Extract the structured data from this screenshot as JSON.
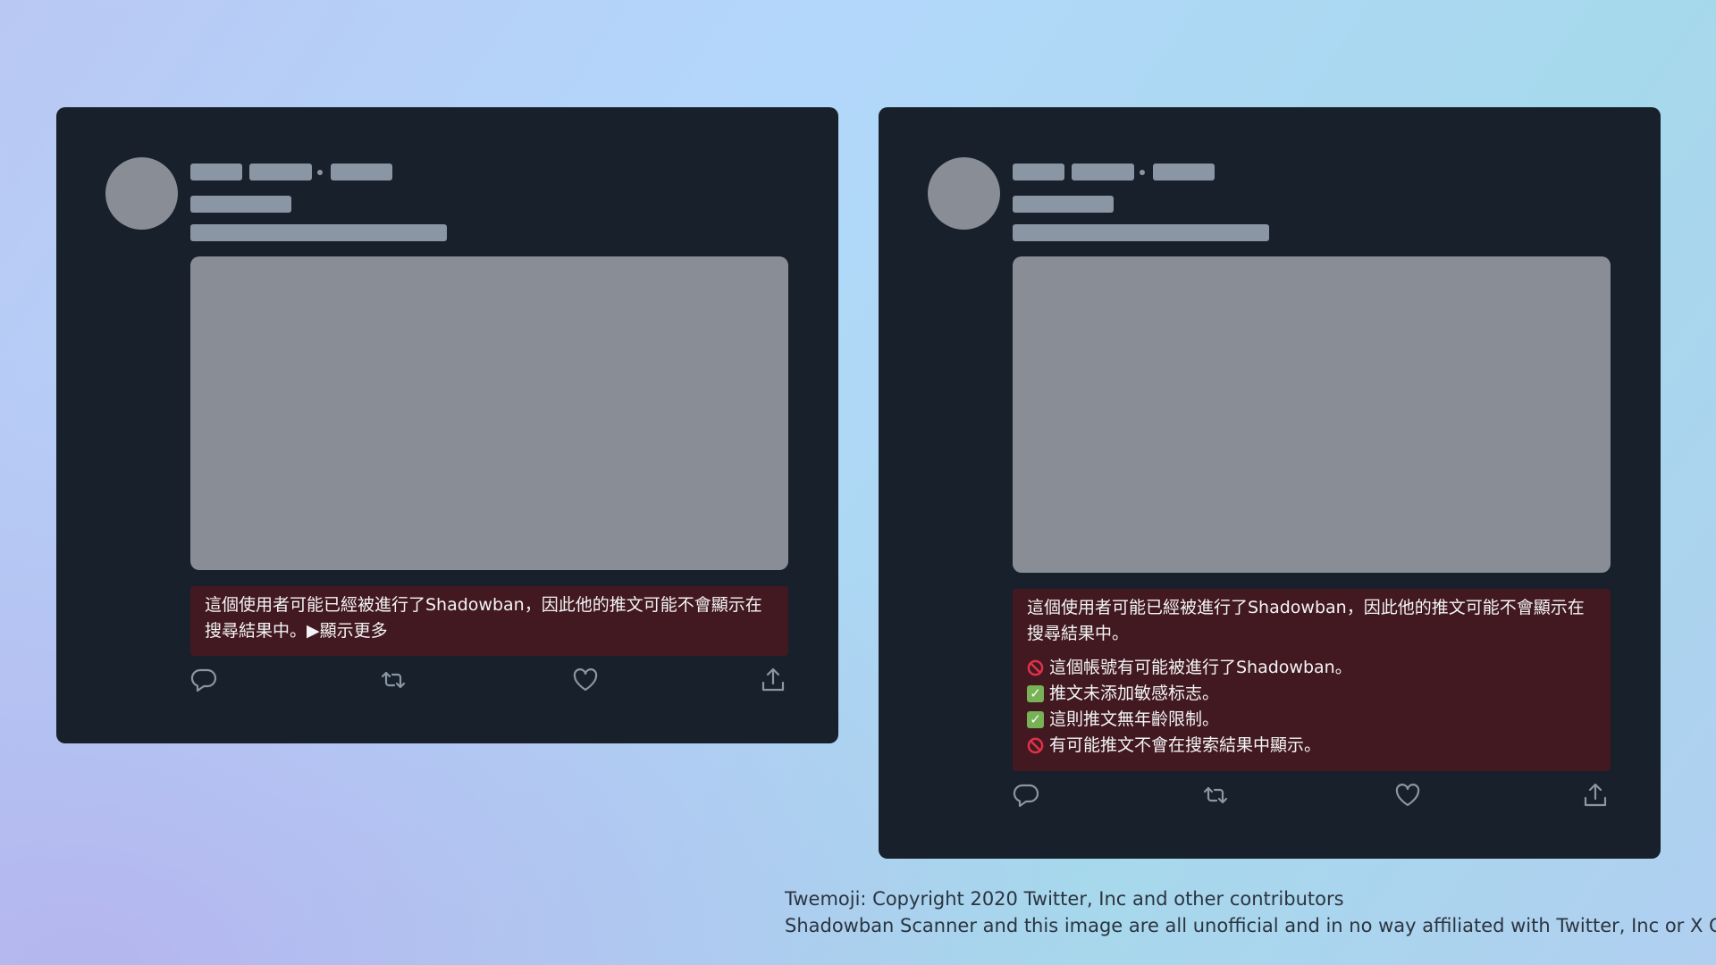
{
  "cards": {
    "left": {
      "notice_text": "這個使用者可能已經被進行了Shadowban，因此他的推文可能不會顯示在搜尋結果中。",
      "show_more": "▶顯示更多"
    },
    "right": {
      "notice_text": "這個使用者可能已經被進行了Shadowban，因此他的推文可能不會顯示在搜尋結果中。",
      "checks": [
        {
          "status": "banned",
          "icon": "no-entry-icon",
          "text": "這個帳號有可能被進行了Shadowban。"
        },
        {
          "status": "ok",
          "icon": "check-mark-icon",
          "text": "推文未添加敏感标志。"
        },
        {
          "status": "ok",
          "icon": "check-mark-icon",
          "text": "這則推文無年齡限制。"
        },
        {
          "status": "banned",
          "icon": "no-entry-icon",
          "text": "有可能推文不會在搜索結果中顯示。"
        }
      ]
    }
  },
  "actions": [
    "reply-icon",
    "retweet-icon",
    "like-icon",
    "share-icon"
  ],
  "footer": {
    "line1": "Twemoji: Copyright 2020 Twitter, Inc and other contributors",
    "line2": "Shadowban Scanner and this image are all unofficial and in no way affiliated with Twitter, Inc or X Corp."
  },
  "colors": {
    "card_bg": "#17202b",
    "placeholder": "#8a96a3",
    "media": "#898d95",
    "notice_bg": "#421920",
    "no_entry": "#e0314b",
    "check_ok": "#77b255"
  }
}
